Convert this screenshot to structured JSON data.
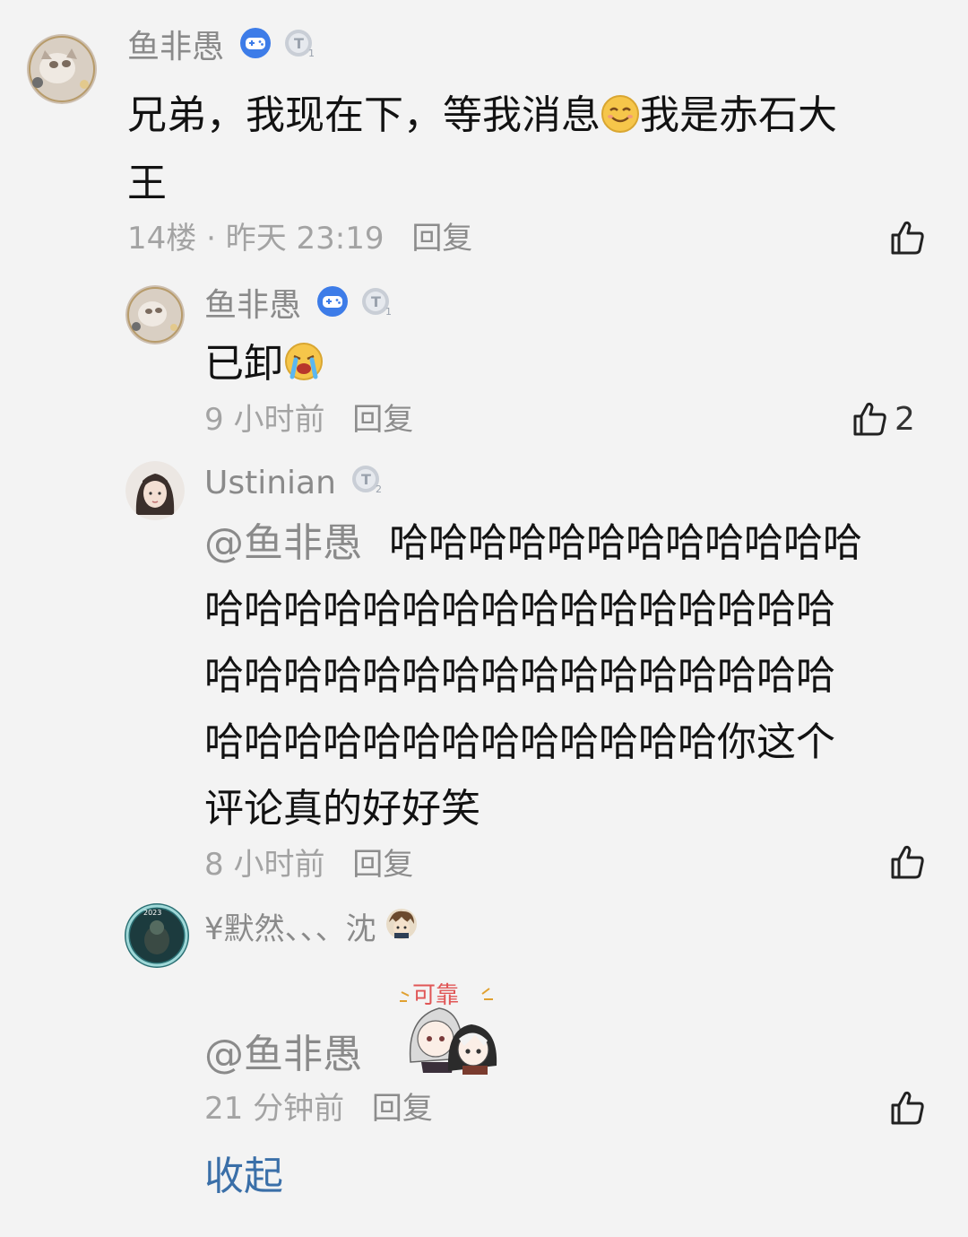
{
  "comments": [
    {
      "username": "鱼非愚",
      "badges": [
        "gamepad-badge",
        "level-badge"
      ],
      "level_number": "1",
      "text_lines": [
        "兄弟，我现在下，等我消息",
        "我是赤石大",
        "王"
      ],
      "emoji": "smile-emoji",
      "floor": "14楼",
      "time": "昨天 23:19",
      "reply_label": "回复",
      "likes": ""
    }
  ],
  "replies": [
    {
      "username": "鱼非愚",
      "badges": [
        "gamepad-badge",
        "level-badge"
      ],
      "level_number": "1",
      "text": "已卸",
      "emoji": "crying-emoji",
      "time": "9 小时前",
      "reply_label": "回复",
      "likes": "2"
    },
    {
      "username": "Ustinian",
      "badges": [
        "level-badge"
      ],
      "level_number": "2",
      "mention": "@鱼非愚",
      "text_lines": [
        "哈哈哈哈哈哈哈哈哈哈哈哈",
        "哈哈哈哈哈哈哈哈哈哈哈哈哈哈哈哈",
        "哈哈哈哈哈哈哈哈哈哈哈哈哈哈哈哈",
        "哈哈哈哈哈哈哈哈哈哈哈哈哈你这个",
        "评论真的好好笑"
      ],
      "time": "8 小时前",
      "reply_label": "回复",
      "likes": ""
    },
    {
      "username": "¥默然、、、沈",
      "badges": [
        "character-avatar-badge"
      ],
      "mention": "@鱼非愚",
      "sticker_text": "可靠",
      "time": "21 分钟前",
      "reply_label": "回复",
      "likes": ""
    }
  ],
  "collapse_label": "收起",
  "colors": {
    "background": "#f3f3f3",
    "username": "#8a8a8a",
    "meta": "#a3a3a3",
    "link": "#3a6fa8",
    "badge_blue": "#3d7ce8"
  }
}
